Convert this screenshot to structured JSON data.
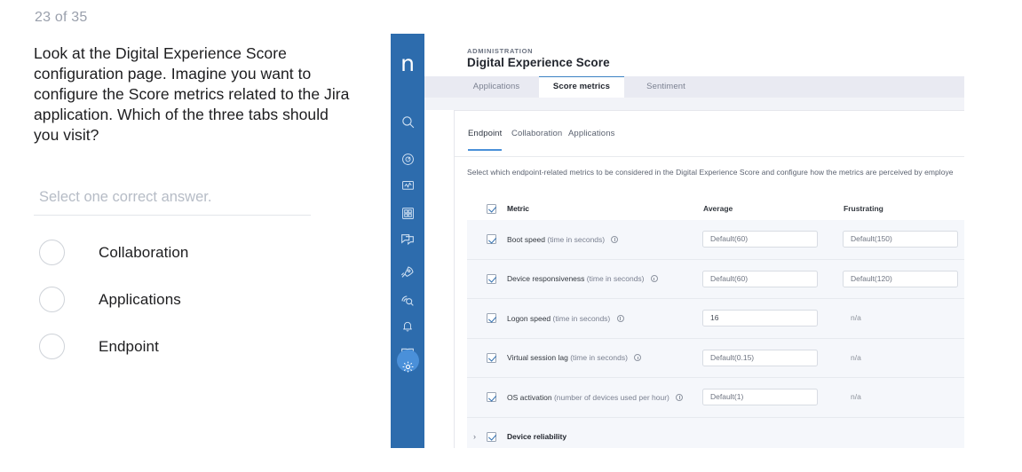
{
  "quiz": {
    "counter": "23 of 35",
    "question": "Look at the Digital Experience Score configuration page. Imagine you want to configure the Score metrics related to the Jira application. Which of the three tabs should you visit?",
    "select_hint": "Select one correct answer.",
    "options": [
      {
        "label": "Collaboration",
        "selected": false
      },
      {
        "label": "Applications",
        "selected": false
      },
      {
        "label": "Endpoint",
        "selected": false
      }
    ]
  },
  "app": {
    "sidebar": {
      "logo": "n",
      "items": [
        {
          "icon": "search-icon"
        },
        {
          "icon": "compass-icon"
        },
        {
          "icon": "analytics-monitor-icon"
        },
        {
          "icon": "apps-grid-icon"
        },
        {
          "icon": "chat-bubbles-icon"
        },
        {
          "icon": "rocket-icon"
        },
        {
          "icon": "diagnostics-search-icon"
        },
        {
          "icon": "bell-icon"
        },
        {
          "icon": "book-icon"
        },
        {
          "icon": "gear-icon",
          "active": true
        }
      ]
    },
    "header": {
      "eyebrow": "ADMINISTRATION",
      "title": "Digital Experience Score"
    },
    "outer_tabs": [
      {
        "label": "Applications",
        "active": false
      },
      {
        "label": "Score metrics",
        "active": true
      },
      {
        "label": "Sentiment",
        "active": false
      }
    ],
    "inner_tabs": [
      {
        "label": "Endpoint",
        "active": true
      },
      {
        "label": "Collaboration",
        "active": false
      },
      {
        "label": "Applications",
        "active": false
      }
    ],
    "description": "Select which endpoint-related metrics to be considered in the Digital Experience Score and configure how the metrics are perceived by employe",
    "table": {
      "headers": {
        "metric": "Metric",
        "average": "Average",
        "frustrating": "Frustrating"
      },
      "rows": [
        {
          "checked": true,
          "name": "Boot speed",
          "unit": "(time in seconds)",
          "average": "Default(60)",
          "frustrating": "Default(150)",
          "average_na": false,
          "frustrating_na": false,
          "expandable": false,
          "bold": false
        },
        {
          "checked": true,
          "name": "Device responsiveness",
          "unit": "(time in seconds)",
          "average": "Default(60)",
          "frustrating": "Default(120)",
          "average_na": false,
          "frustrating_na": false,
          "expandable": false,
          "bold": false
        },
        {
          "checked": true,
          "name": "Logon speed",
          "unit": "(time in seconds)",
          "average": "16",
          "frustrating": "n/a",
          "average_na": false,
          "frustrating_na": true,
          "expandable": false,
          "bold": false
        },
        {
          "checked": true,
          "name": "Virtual session lag",
          "unit": "(time in seconds)",
          "average": "Default(0.15)",
          "frustrating": "n/a",
          "average_na": false,
          "frustrating_na": true,
          "expandable": false,
          "bold": false
        },
        {
          "checked": true,
          "name": "OS activation",
          "unit": "(number of devices used per hour)",
          "average": "Default(1)",
          "frustrating": "n/a",
          "average_na": false,
          "frustrating_na": true,
          "expandable": false,
          "bold": false
        },
        {
          "checked": true,
          "name": "Device reliability",
          "unit": "",
          "average": "",
          "frustrating": "",
          "average_na": false,
          "frustrating_na": false,
          "expandable": true,
          "bold": true
        }
      ]
    }
  },
  "colors": {
    "sidebar_blue": "#2d6cad",
    "active_pill": "#4a90d9",
    "tab_accent": "#3b82c4",
    "row_bg": "#f5f7fb",
    "tabstrip_bg": "#e9eaf2"
  }
}
